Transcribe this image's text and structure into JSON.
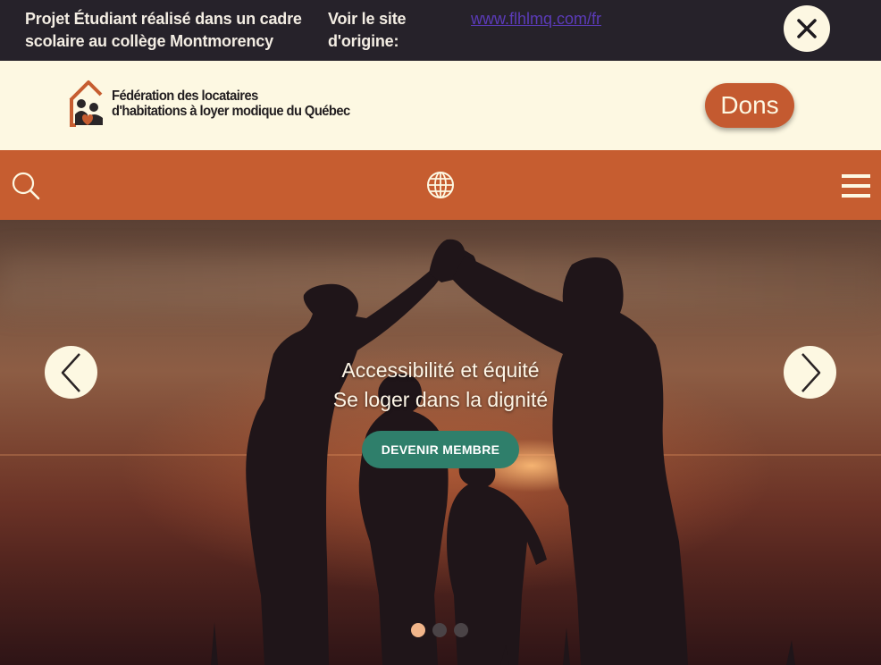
{
  "notice": {
    "text": "Projet Étudiant réalisé dans un cadre scolaire au collège Montmorency",
    "link_label": "Voir le site d'origine:",
    "link_url_text": "www.flhlmq.com/fr",
    "close_icon": "close-icon"
  },
  "header": {
    "logo_line1": "Fédération des locataires",
    "logo_line2": "d'habitations à loyer modique du Québec",
    "donate_label": "Dons"
  },
  "navbar": {
    "icons": [
      "search-icon",
      "globe-icon",
      "hamburger-menu-icon"
    ]
  },
  "hero": {
    "title_line1": "Accessibilité et équité",
    "title_line2": "Se loger dans la dignité",
    "cta_label": "DEVENIR MEMBRE",
    "slides": {
      "count": 3,
      "active_index": 0
    },
    "prev_icon": "chevron-left-icon",
    "next_icon": "chevron-right-icon"
  },
  "colors": {
    "notice_bg": "#26222a",
    "header_bg": "#fdf8e2",
    "brand_orange": "#c65d30",
    "cta_green": "#2f7f6b",
    "link_purple": "#5b3bb8",
    "dot_active": "#f1b58a",
    "dot_inactive": "#4a4346"
  }
}
